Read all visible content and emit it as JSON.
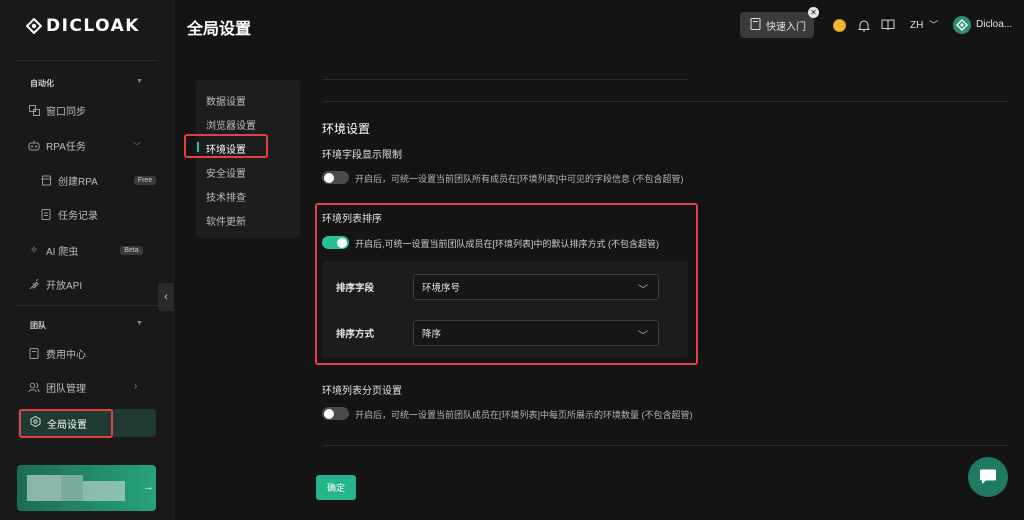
{
  "brand": {
    "name": "DICLOAK"
  },
  "header": {
    "title": "全局设置",
    "quick_start": "快速入门",
    "lang": "ZH",
    "username": "Dicloa..."
  },
  "sidebar": {
    "automation": {
      "title": "自动化",
      "items": [
        {
          "label": "窗口同步"
        },
        {
          "label": "RPA任务"
        },
        {
          "label": "创建RPA",
          "badge": "Free"
        },
        {
          "label": "任务记录"
        },
        {
          "label": "AI 爬虫",
          "badge": "Beta"
        },
        {
          "label": "开放API"
        }
      ]
    },
    "team": {
      "title": "团队",
      "items": [
        {
          "label": "费用中心"
        },
        {
          "label": "团队管理"
        },
        {
          "label": "全局设置"
        }
      ]
    }
  },
  "subnav": {
    "items": [
      {
        "label": "数据设置"
      },
      {
        "label": "浏览器设置"
      },
      {
        "label": "环境设置"
      },
      {
        "label": "安全设置"
      },
      {
        "label": "技术排查"
      },
      {
        "label": "软件更新"
      }
    ],
    "active_index": 2
  },
  "content": {
    "section_title": "环境设置",
    "field_limit": {
      "label": "环境字段显示限制",
      "enabled": false,
      "desc": "开启后，可统一设置当前团队所有成员在[环境列表]中可见的字段信息 (不包含超管)"
    },
    "list_sort": {
      "label": "环境列表排序",
      "enabled": true,
      "desc": "开启后,可统一设置当前团队成员在[环境列表]中的默认排序方式 (不包含超管)",
      "sort_field_label": "排序字段",
      "sort_field_value": "环境序号",
      "sort_order_label": "排序方式",
      "sort_order_value": "降序"
    },
    "pagination": {
      "label": "环境列表分页设置",
      "enabled": false,
      "desc": "开启后，可统一设置当前团队成员在[环境列表]中每页所展示的环境数量 (不包含超管)"
    },
    "confirm": "确定"
  },
  "colors": {
    "accent": "#25c29a",
    "highlight": "#e44040",
    "background": "#141414"
  }
}
